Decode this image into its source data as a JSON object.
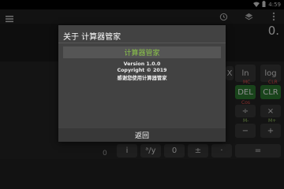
{
  "status": {
    "time": "4:59"
  },
  "display": {
    "value": "0."
  },
  "keys": {
    "ln": "ln",
    "log": "log",
    "x": "X",
    "del": "DEL",
    "clr": "CLR",
    "div": "÷",
    "mul": "×",
    "minus": "−",
    "plus": "+",
    "eq": "=",
    "i": "i",
    "frac": "ᵃ/y",
    "zero": "0",
    "pm": "±",
    "dot": "·",
    "mc": "MC",
    "clr_small": "CLR",
    "cos": "Cos",
    "mminus": "M-",
    "mplus": "M+",
    "bottom_zero": "0"
  },
  "dialog": {
    "title": "关于 计算器管家",
    "app_name": "计算器管家",
    "version": "Version 1.0.0",
    "copyright": "Copyright © 2019",
    "thanks": "感谢您使用计算器管家",
    "back_label": "返回"
  },
  "icons": {
    "menu": "menu-icon",
    "history": "history-icon",
    "layers": "layers-icon",
    "more": "more-vert-icon"
  },
  "colors": {
    "accent": "#8bc34a",
    "delete": "#2e7d32",
    "dialog_bg": "#424242"
  }
}
